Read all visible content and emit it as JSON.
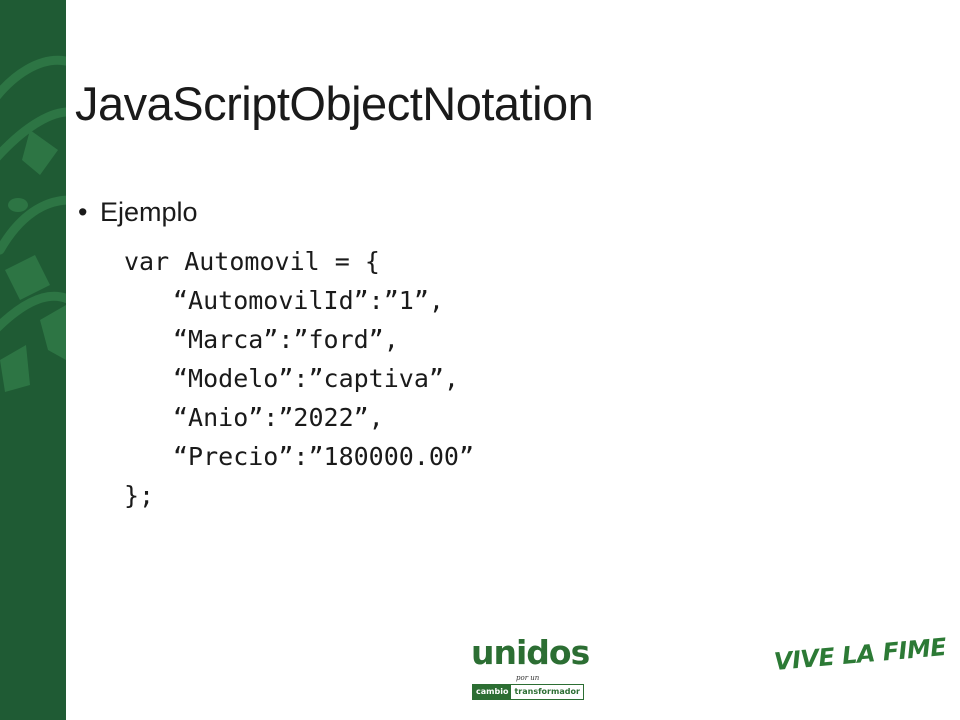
{
  "slide": {
    "title": "JavaScriptObjectNotation",
    "bullet": {
      "marker": "•",
      "text": "Ejemplo"
    },
    "code_lines": [
      "var Automovil = {",
      "“AutomovilId”:”1”,",
      "“Marca”:”ford”,",
      "“Modelo”:”captiva”,",
      "“Anio”:”2022”,",
      "“Precio”:”180000.00”",
      "};"
    ]
  },
  "footer": {
    "unidos_logo": {
      "word": "unidos",
      "small": "por un",
      "cambio": "cambio",
      "transformador": "transformador"
    },
    "vive_logo": "VIVE LA FIME"
  },
  "colors": {
    "side_band": "#1f5b34",
    "logo_green": "#2c6e33",
    "text": "#1a1a1a"
  },
  "decorations": {
    "side_band_graphic": "tiger-emblem-icon"
  }
}
